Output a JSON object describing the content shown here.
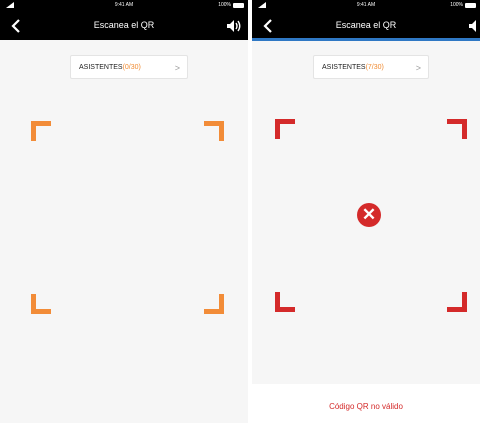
{
  "screens": [
    {
      "status": {
        "time": "9:41 AM",
        "battery": "100%"
      },
      "nav": {
        "title": "Escanea el QR"
      },
      "attendees": {
        "label": "ASISTENTES",
        "count": "(0/30)",
        "chevron": ">"
      },
      "frame_color": "#f28c38"
    },
    {
      "status": {
        "time": "9:41 AM",
        "battery": "100%"
      },
      "nav": {
        "title": "Escanea el QR"
      },
      "attendees": {
        "label": "ASISTENTES",
        "count": "(7/30)",
        "chevron": ">"
      },
      "frame_color": "#d42a2a",
      "error_icon": "error-x-icon",
      "error_message": "Código QR no válido"
    }
  ],
  "colors": {
    "accent": "#f28c38",
    "error": "#d42a2a",
    "nav_underline": "#2f78c4"
  }
}
